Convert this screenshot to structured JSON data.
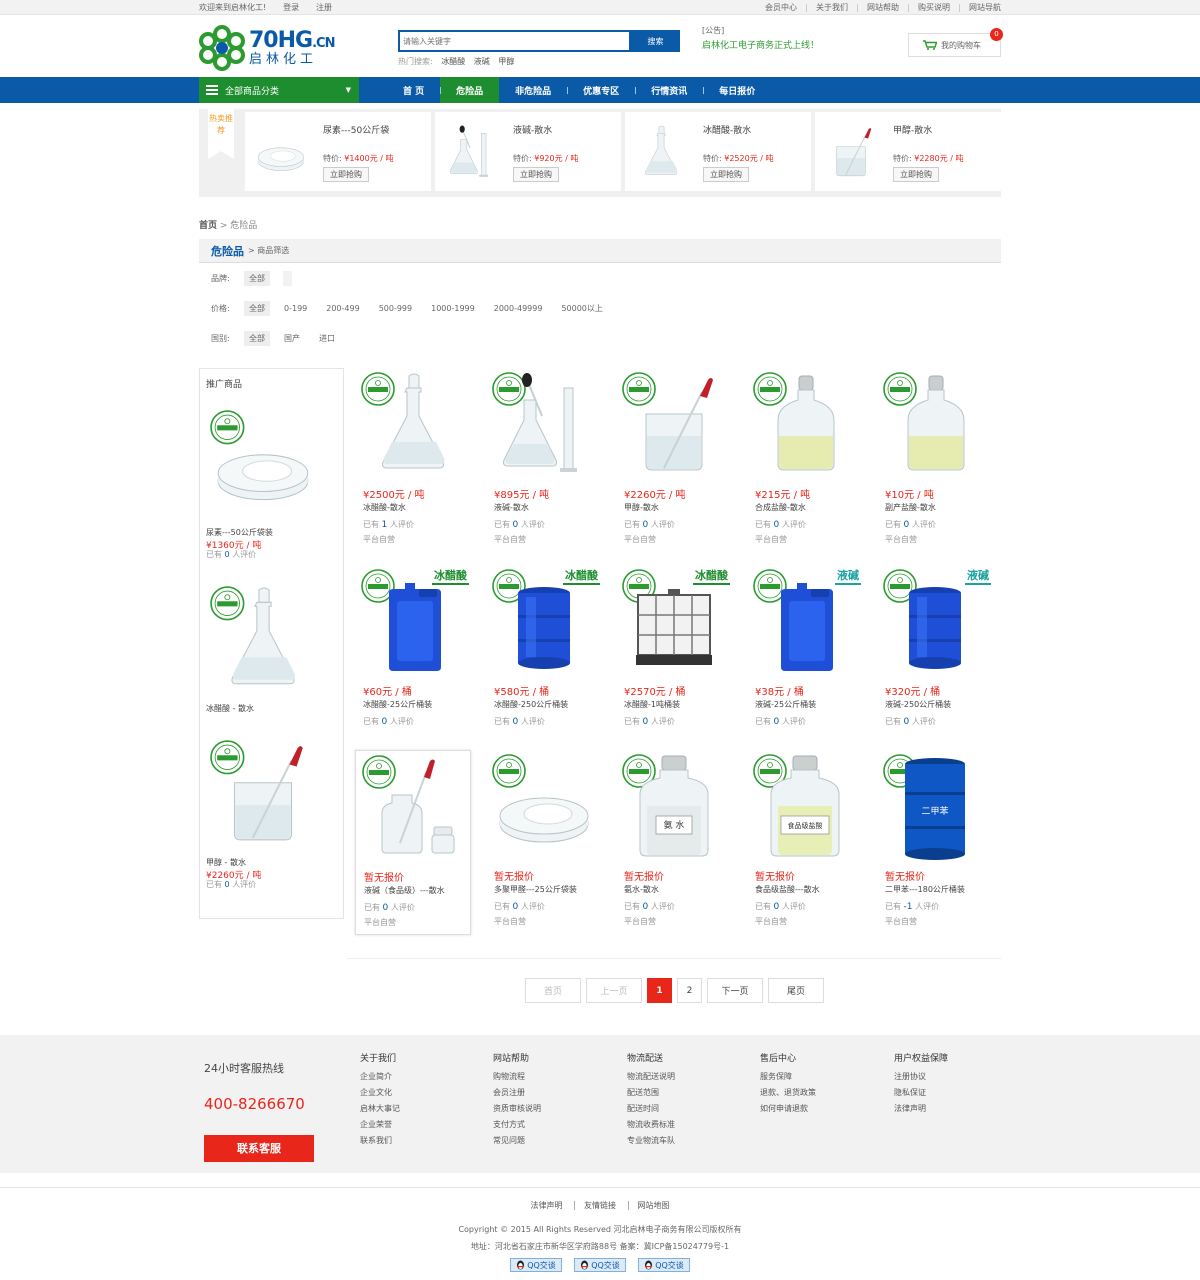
{
  "topbar": {
    "welcome": "欢迎来到启林化工!",
    "login": "登录",
    "register": "注册",
    "links": [
      "会员中心",
      "关于我们",
      "网站帮助",
      "购买说明",
      "网站导航"
    ]
  },
  "logo": {
    "brand": "70HG",
    "domain": ".CN",
    "cn_name": "启林化工"
  },
  "search": {
    "placeholder": "请输入关键字",
    "button": "搜索",
    "hot_label": "热门搜索:",
    "hot_terms": [
      "冰醋酸",
      "液碱",
      "甲醇"
    ]
  },
  "notice": {
    "tag": "[公告]",
    "message": "启林化工电子商务正式上线！"
  },
  "cart": {
    "label": "我的购物车",
    "count": "0"
  },
  "nav": {
    "category_button": "全部商品分类",
    "items": [
      "首 页",
      "危险品",
      "非危险品",
      "优惠专区",
      "行情资讯",
      "每日报价"
    ],
    "active_index": 1
  },
  "hot_recommend": {
    "tag": "热卖推荐",
    "buy_label": "立即抢购",
    "price_label": "特价:",
    "items": [
      {
        "name": "尿素---50公斤袋",
        "price": "¥1400元 / 吨",
        "image": "petri-dish"
      },
      {
        "name": "液碱-散水",
        "price": "¥920元 / 吨",
        "image": "flask-dropper"
      },
      {
        "name": "冰醋酸-散水",
        "price": "¥2520元 / 吨",
        "image": "flask"
      },
      {
        "name": "甲醇-散水",
        "price": "¥2280元 / 吨",
        "image": "beaker"
      }
    ]
  },
  "breadcrumb": {
    "home": "首页",
    "sep": " > ",
    "current": "危险品"
  },
  "filter": {
    "category": "危险品",
    "sub": "> 商品筛选",
    "rows": [
      {
        "label": "品牌:",
        "options": [
          "全部"
        ],
        "selected": 0
      },
      {
        "label": "价格:",
        "options": [
          "全部",
          "0-199",
          "200-499",
          "500-999",
          "1000-1999",
          "2000-49999",
          "50000以上"
        ],
        "selected": 0
      },
      {
        "label": "国别:",
        "options": [
          "全部",
          "国产",
          "进口"
        ],
        "selected": 0
      }
    ]
  },
  "sidebar": {
    "title": "推广商品",
    "eval_prefix": "已有",
    "eval_suffix": "人评价",
    "items": [
      {
        "name": "尿素---50公斤袋装",
        "price": "¥1360元 / 吨",
        "reviews": "0",
        "image": "petri-dish"
      },
      {
        "name": "冰醋酸 - 散水",
        "price": "",
        "reviews": "",
        "image": "flask"
      },
      {
        "name": "甲醇 - 散水",
        "price": "¥2260元 / 吨",
        "reviews": "0",
        "image": "beaker"
      }
    ]
  },
  "products": {
    "eval_prefix": "已有",
    "eval_suffix": "人评价",
    "self_label": "平台自营",
    "items": [
      {
        "price": "¥2500元 / 吨",
        "name": "冰醋酸-散水",
        "reviews": "1",
        "self": true,
        "image": "flask",
        "ribbon": ""
      },
      {
        "price": "¥895元 / 吨",
        "name": "液碱-散水",
        "reviews": "0",
        "self": true,
        "image": "flask-dropper",
        "ribbon": ""
      },
      {
        "price": "¥2260元 / 吨",
        "name": "甲醇-散水",
        "reviews": "0",
        "self": true,
        "image": "beaker",
        "ribbon": ""
      },
      {
        "price": "¥215元 / 吨",
        "name": "合成盐酸-散水",
        "reviews": "0",
        "self": true,
        "image": "reagent-bottle",
        "ribbon": ""
      },
      {
        "price": "¥10元 / 吨",
        "name": "副产盐酸-散水",
        "reviews": "0",
        "self": true,
        "image": "reagent-bottle",
        "ribbon": ""
      },
      {
        "price": "¥60元 / 桶",
        "name": "冰醋酸-25公斤桶装",
        "reviews": "0",
        "self": false,
        "image": "jerrycan",
        "ribbon": "冰醋酸",
        "ribbon_color": "green"
      },
      {
        "price": "¥580元 / 桶",
        "name": "冰醋酸-250公斤桶装",
        "reviews": "0",
        "self": false,
        "image": "drum",
        "ribbon": "冰醋酸",
        "ribbon_color": "green"
      },
      {
        "price": "¥2570元 / 桶",
        "name": "冰醋酸-1吨桶装",
        "reviews": "0",
        "self": false,
        "image": "ibc",
        "ribbon": "冰醋酸",
        "ribbon_color": "green"
      },
      {
        "price": "¥38元 / 桶",
        "name": "液碱-25公斤桶装",
        "reviews": "0",
        "self": false,
        "image": "jerrycan",
        "ribbon": "液碱",
        "ribbon_color": "teal"
      },
      {
        "price": "¥320元 / 桶",
        "name": "液碱-250公斤桶装",
        "reviews": "0",
        "self": false,
        "image": "drum",
        "ribbon": "液碱",
        "ribbon_color": "teal"
      },
      {
        "price": "暂无报价",
        "name": "液碱（食品级）---散水",
        "reviews": "0",
        "self": true,
        "image": "bottle-dropper",
        "ribbon": "",
        "highlight": true
      },
      {
        "price": "暂无报价",
        "name": "多聚甲醛---25公斤袋装",
        "reviews": "0",
        "self": true,
        "image": "petri-dish",
        "ribbon": ""
      },
      {
        "price": "暂无报价",
        "name": "氨水-散水",
        "reviews": "0",
        "self": true,
        "image": "labeled-bottle",
        "label": "氨 水",
        "ribbon": ""
      },
      {
        "price": "暂无报价",
        "name": "食品级盐酸---散水",
        "reviews": "0",
        "self": true,
        "image": "labeled-bottle-yellow",
        "label": "食品级盐酸",
        "ribbon": ""
      },
      {
        "price": "暂无报价",
        "name": "二甲苯---180公斤桶装",
        "reviews": "-1",
        "self": true,
        "image": "steel-drum",
        "label": "二甲苯",
        "ribbon": ""
      }
    ]
  },
  "pager": {
    "first": "首页",
    "prev": "上一页",
    "pages": [
      "1",
      "2"
    ],
    "current": "1",
    "next": "下一页",
    "last": "尾页"
  },
  "footer": {
    "hotline_label": "24小时客服热线",
    "phone": "400-8266670",
    "contact_button": "联系客服",
    "columns": [
      {
        "title": "关于我们",
        "links": [
          "企业简介",
          "企业文化",
          "启林大事记",
          "企业荣誉",
          "联系我们"
        ]
      },
      {
        "title": "网站帮助",
        "links": [
          "购物流程",
          "会员注册",
          "资质审核说明",
          "支付方式",
          "常见问题"
        ]
      },
      {
        "title": "物流配送",
        "links": [
          "物流配送说明",
          "配送范围",
          "配送时间",
          "物流收费标准",
          "专业物流车队"
        ]
      },
      {
        "title": "售后中心",
        "links": [
          "服务保障",
          "退款、退货政策",
          "如何申请退款"
        ]
      },
      {
        "title": "用户权益保障",
        "links": [
          "注册协议",
          "隐私保证",
          "法律声明"
        ]
      }
    ]
  },
  "bottom": {
    "links": [
      "法律声明",
      "友情链接",
      "网站地图"
    ],
    "copyright": "Copyright © 2015 All Rights Reserved    河北启林电子商务有限公司版权所有",
    "address": "地址：河北省石家庄市新华区学府路88号    备案：冀ICP备15024779号-1",
    "qq_label": "QQ交谈",
    "qq_count": 3
  },
  "colors": {
    "primary_blue": "#0b5aa8",
    "green": "#1d8d2f",
    "red": "#e8261a",
    "teal": "#1aa3a3"
  }
}
